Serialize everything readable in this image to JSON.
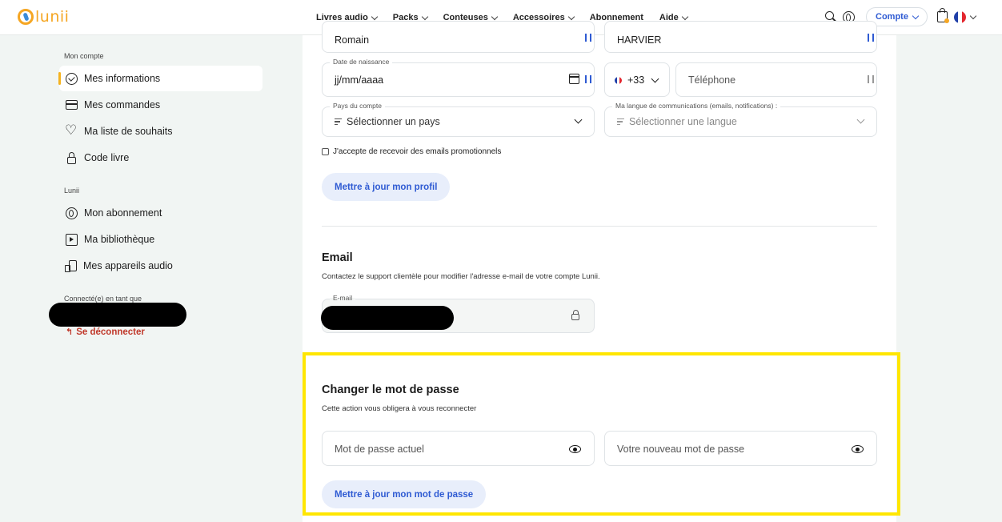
{
  "header": {
    "logo_text": "lunii",
    "nav": [
      {
        "label": "Livres audio",
        "has_dropdown": true
      },
      {
        "label": "Packs",
        "has_dropdown": true
      },
      {
        "label": "Conteuses",
        "has_dropdown": true
      },
      {
        "label": "Accessoires",
        "has_dropdown": true
      },
      {
        "label": "Abonnement",
        "has_dropdown": false
      },
      {
        "label": "Aide",
        "has_dropdown": true
      }
    ],
    "account_label": "Compte",
    "icons": [
      "search-icon",
      "lunii-device-icon",
      "cart-icon",
      "flag-fr-icon"
    ]
  },
  "sidebar": {
    "section_account": "Mon compte",
    "account_items": [
      {
        "label": "Mes informations",
        "icon": "smile-check-icon",
        "active": true
      },
      {
        "label": "Mes commandes",
        "icon": "credit-card-icon"
      },
      {
        "label": "Ma liste de souhaits",
        "icon": "heart-icon"
      },
      {
        "label": "Code livre",
        "icon": "lock-icon"
      }
    ],
    "section_lunii": "Lunii",
    "lunii_items": [
      {
        "label": "Mon abonnement",
        "icon": "subscription-icon"
      },
      {
        "label": "Ma bibliothèque",
        "icon": "library-icon"
      },
      {
        "label": "Mes appareils audio",
        "icon": "devices-icon"
      }
    ],
    "connected_label": "Connecté(e) en tant que",
    "logout_label": "Se déconnecter"
  },
  "profile": {
    "first_name_value": "Romain",
    "last_name_value": "HARVIER",
    "birthdate": {
      "label": "Date de naissance",
      "value": "jj/mm/aaaa"
    },
    "phone_prefix": "+33",
    "phone_placeholder": "Téléphone",
    "country": {
      "label": "Pays du compte",
      "placeholder": "Sélectionner un pays"
    },
    "language": {
      "label": "Ma langue de communications (emails, notifications) :",
      "placeholder": "Sélectionner une langue"
    },
    "newsletter_label": "J'accepte de recevoir des emails promotionnels",
    "update_button": "Mettre à jour mon profil"
  },
  "email_section": {
    "title": "Email",
    "description": "Contactez le support clientèle pour modifier l'adresse e-mail de votre compte Lunii.",
    "field_label": "E-mail"
  },
  "password_section": {
    "title": "Changer le mot de passe",
    "description": "Cette action vous obligera à vous reconnecter",
    "current_placeholder": "Mot de passe actuel",
    "new_placeholder": "Votre nouveau mot de passe",
    "update_button": "Mettre à jour mon mot de passe"
  },
  "colors": {
    "accent_blue": "#2f5bd3",
    "brand_orange": "#f5a623",
    "logout_red": "#c0392b",
    "highlight_yellow": "#ffe600"
  }
}
